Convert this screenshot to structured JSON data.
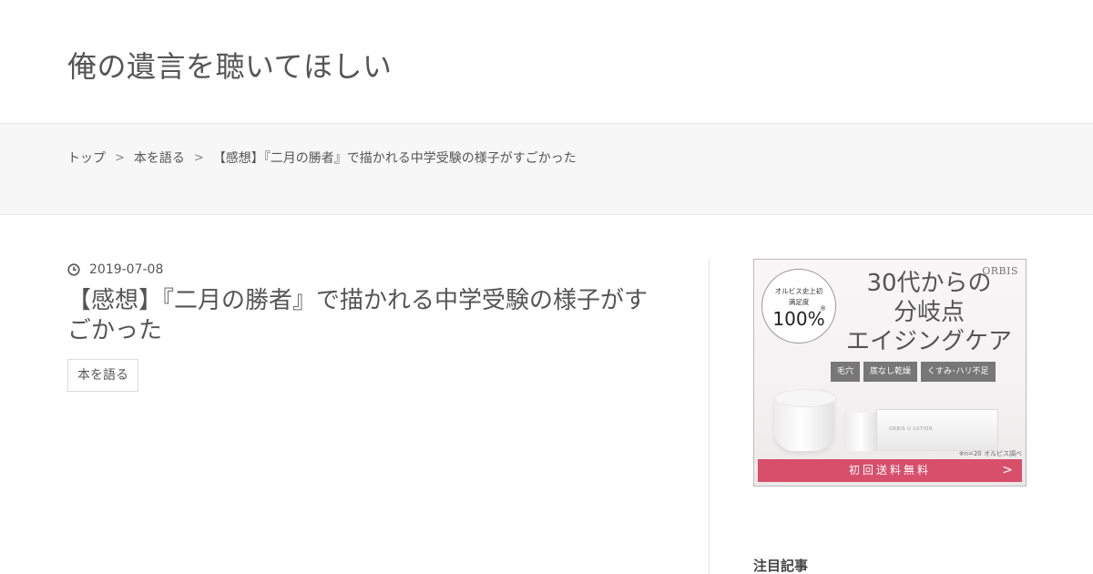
{
  "site": {
    "title": "俺の遺言を聴いてほしい"
  },
  "breadcrumb": {
    "separator": ">",
    "items": [
      "トップ",
      "本を語る",
      "【感想】『二月の勝者』で描かれる中学受験の様子がすごかった"
    ]
  },
  "post": {
    "date": "2019-07-08",
    "title": "【感想】『二月の勝者』で描かれる中学受験の様子がすごかった",
    "category": "本を語る"
  },
  "ad": {
    "brand": "ORBIS",
    "badge_line1": "オルビス史上初",
    "badge_line2": "満足度",
    "badge_value": "100%",
    "badge_mark": "※",
    "headline_line1": "30代からの",
    "headline_line2": "分岐点",
    "headline_line3": "エイジングケア",
    "tags": [
      "毛穴",
      "底なし乾燥",
      "くすみ･ハリ不足"
    ],
    "product_label": "ORBIS U LOTION",
    "note": "※n=20 オルビス調べ",
    "cta": "初回送料無料",
    "cta_icon": ">",
    "accent_color": "#d84f6b"
  },
  "sidebar": {
    "heading": "注目記事"
  }
}
